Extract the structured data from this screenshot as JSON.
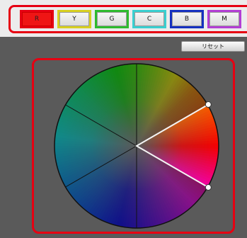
{
  "colors": {
    "accent_frame": "#e60012",
    "background": "#5a5a5a"
  },
  "tabs": [
    {
      "label": "R",
      "border": "#e60012",
      "active": true
    },
    {
      "label": "Y",
      "border": "#d8d020",
      "active": false
    },
    {
      "label": "G",
      "border": "#2dbb2d",
      "active": false
    },
    {
      "label": "C",
      "border": "#39cfd0",
      "active": false
    },
    {
      "label": "B",
      "border": "#1530c0",
      "active": false
    },
    {
      "label": "M",
      "border": "#b33ed4",
      "active": false
    }
  ],
  "reset_button": {
    "label": "リセット"
  },
  "wheel": {
    "selected_range_color": "red",
    "icons": [
      "handle-upper",
      "handle-lower"
    ]
  }
}
